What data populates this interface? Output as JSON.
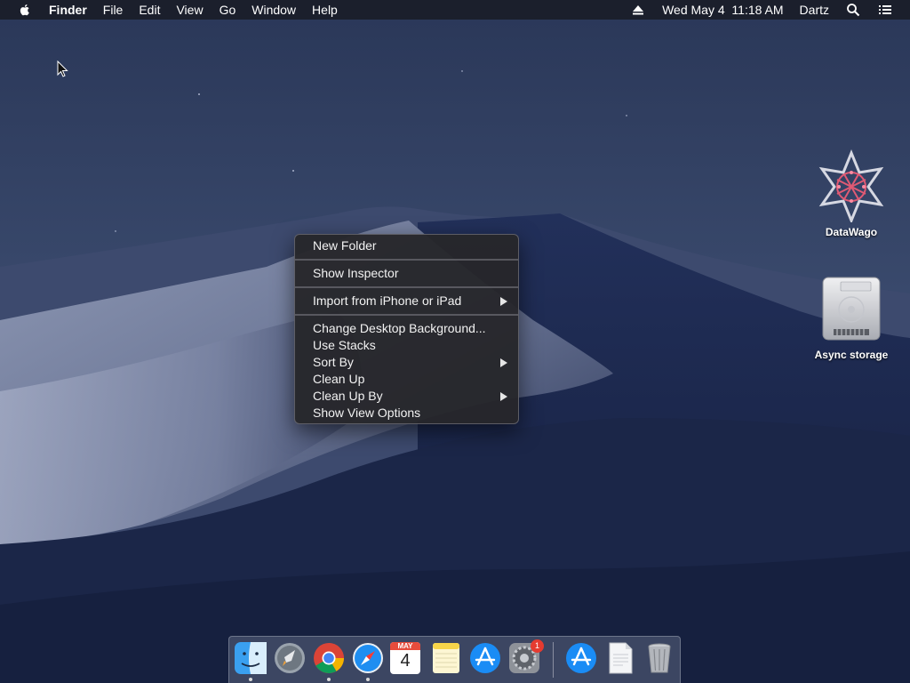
{
  "menubar": {
    "app_name": "Finder",
    "menus": [
      "File",
      "Edit",
      "View",
      "Go",
      "Window",
      "Help"
    ],
    "datetime": "Wed May 4  11:18 AM",
    "user": "Dartz"
  },
  "context_menu": {
    "items": [
      "New Folder",
      "Show Inspector",
      "Import from iPhone or iPad",
      "Change Desktop Background...",
      "Use Stacks",
      "Sort By",
      "Clean Up",
      "Clean Up By",
      "Show View Options"
    ]
  },
  "desktop_icons": [
    {
      "label": "DataWago",
      "icon": "datawago-icon"
    },
    {
      "label": "Async storage",
      "icon": "hard-drive-icon"
    }
  ],
  "dock": {
    "apps": [
      {
        "icon": "finder-icon",
        "running": true
      },
      {
        "icon": "launchpad-icon",
        "running": false
      },
      {
        "icon": "chrome-icon",
        "running": true
      },
      {
        "icon": "safari-icon",
        "running": true
      },
      {
        "icon": "calendar-icon",
        "running": false
      },
      {
        "icon": "notes-icon",
        "running": false
      },
      {
        "icon": "app-store-icon",
        "running": false
      },
      {
        "icon": "system-preferences-icon",
        "running": false
      },
      {
        "icon": "app-store-icon",
        "running": false
      },
      {
        "icon": "document-icon",
        "running": false
      },
      {
        "icon": "trash-icon",
        "running": false
      }
    ],
    "calendar_month": "MAY",
    "calendar_day": "4",
    "sysprefs_badge": "1"
  }
}
